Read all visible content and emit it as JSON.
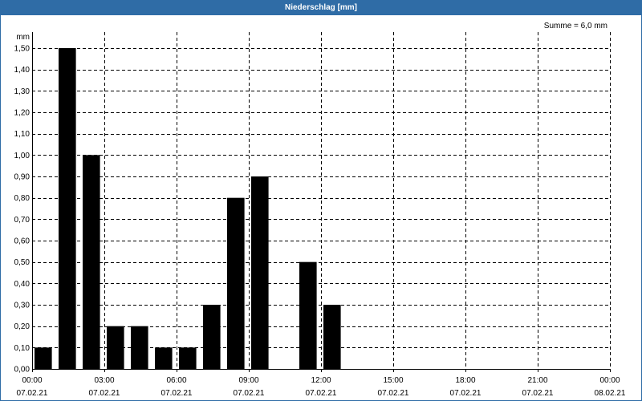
{
  "colors": {
    "title_bar": "#2f6ca6",
    "title_text": "#ffffff",
    "bars": "#000000",
    "gridlines": "#000000",
    "background": "#ffffff"
  },
  "chart_data": {
    "type": "bar",
    "title": "Niederschlag [mm]",
    "ylabel": "mm",
    "ylim": [
      0,
      1.5
    ],
    "xlim": [
      "07.02.21 00:00",
      "08.02.21 00:00"
    ],
    "grid": true,
    "annotations": [
      "Summe = 6,0 mm"
    ],
    "yticks": [
      {
        "value": 0.0,
        "label": "0,00"
      },
      {
        "value": 0.1,
        "label": "0,10"
      },
      {
        "value": 0.2,
        "label": "0,20"
      },
      {
        "value": 0.3,
        "label": "0,30"
      },
      {
        "value": 0.4,
        "label": "0,40"
      },
      {
        "value": 0.5,
        "label": "0,50"
      },
      {
        "value": 0.6,
        "label": "0,60"
      },
      {
        "value": 0.7,
        "label": "0,70"
      },
      {
        "value": 0.8,
        "label": "0,80"
      },
      {
        "value": 0.9,
        "label": "0,90"
      },
      {
        "value": 1.0,
        "label": "1,00"
      },
      {
        "value": 1.1,
        "label": "1,10"
      },
      {
        "value": 1.2,
        "label": "1,20"
      },
      {
        "value": 1.3,
        "label": "1,30"
      },
      {
        "value": 1.4,
        "label": "1,40"
      },
      {
        "value": 1.5,
        "label": "1,50"
      }
    ],
    "x_ticks": [
      {
        "time": "00:00",
        "date": "07.02.21"
      },
      {
        "time": "03:00",
        "date": "07.02.21"
      },
      {
        "time": "06:00",
        "date": "07.02.21"
      },
      {
        "time": "09:00",
        "date": "07.02.21"
      },
      {
        "time": "12:00",
        "date": "07.02.21"
      },
      {
        "time": "15:00",
        "date": "07.02.21"
      },
      {
        "time": "18:00",
        "date": "07.02.21"
      },
      {
        "time": "21:00",
        "date": "07.02.21"
      },
      {
        "time": "00:00",
        "date": "08.02.21"
      }
    ],
    "x": [
      "07.02.21 00:00",
      "07.02.21 01:00",
      "07.02.21 02:00",
      "07.02.21 03:00",
      "07.02.21 04:00",
      "07.02.21 05:00",
      "07.02.21 06:00",
      "07.02.21 07:00",
      "07.02.21 08:00",
      "07.02.21 09:00",
      "07.02.21 10:00",
      "07.02.21 11:00",
      "07.02.21 12:00"
    ],
    "values": [
      0.1,
      1.5,
      1.0,
      0.2,
      0.2,
      0.1,
      0.1,
      0.3,
      0.8,
      0.9,
      0.0,
      0.5,
      0.3
    ]
  }
}
